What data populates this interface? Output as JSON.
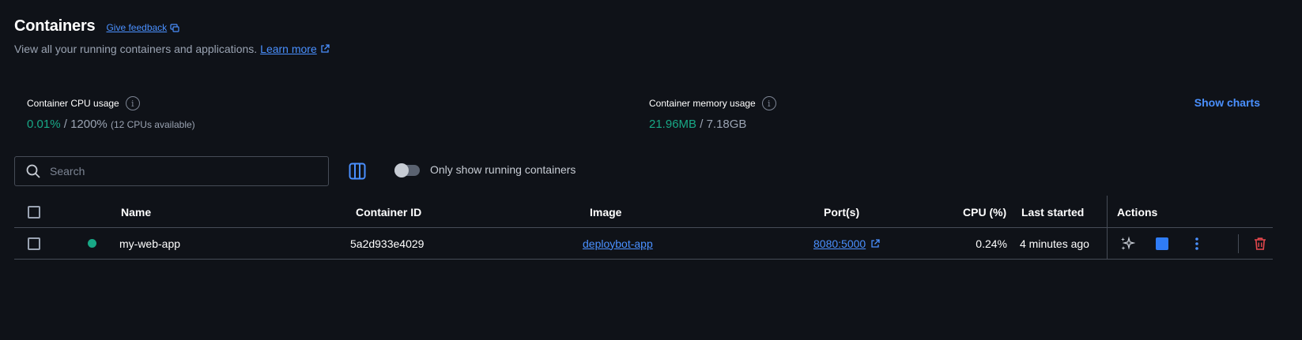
{
  "header": {
    "title": "Containers",
    "feedback_label": "Give feedback",
    "subtitle": "View all your running containers and applications.",
    "learn_more_label": "Learn more"
  },
  "stats": {
    "cpu": {
      "label": "Container CPU usage",
      "used": "0.01%",
      "separator": " / ",
      "total": "1200%",
      "note": "(12 CPUs available)"
    },
    "memory": {
      "label": "Container memory usage",
      "used": "21.96MB",
      "separator": " / ",
      "total": "7.18GB"
    },
    "show_charts_label": "Show charts"
  },
  "toolbar": {
    "search_placeholder": "Search",
    "toggle_label": "Only show running containers",
    "toggle_on": false
  },
  "table": {
    "columns": {
      "name": "Name",
      "container_id": "Container ID",
      "image": "Image",
      "ports": "Port(s)",
      "cpu": "CPU (%)",
      "last_started": "Last started",
      "actions": "Actions"
    },
    "rows": [
      {
        "status": "running",
        "name": "my-web-app",
        "container_id": "5a2d933e4029",
        "image": "deploybot-app",
        "ports": "8080:5000",
        "cpu": "0.24%",
        "last_started": "4 minutes ago"
      }
    ]
  },
  "colors": {
    "background": "#0f1218",
    "accent": "#4a90ff",
    "running": "#18a886",
    "danger": "#e5484d",
    "stop": "#2f7cf6"
  },
  "icons": [
    "external-link-icon",
    "info-icon",
    "search-icon",
    "columns-icon",
    "ai-sparkle-icon",
    "stop-icon",
    "more-vertical-icon",
    "trash-icon"
  ]
}
